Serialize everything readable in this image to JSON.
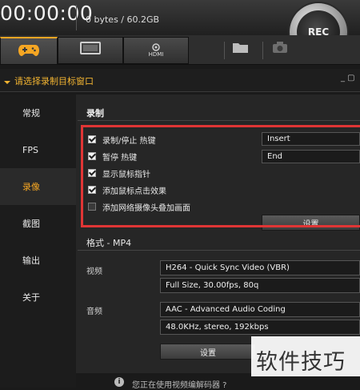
{
  "header": {
    "timer": "00:00:00",
    "storage": "0 bytes / 60.2GB",
    "rec_label": "REC"
  },
  "tabs": [
    {
      "name": "game",
      "icon": "gamepad-icon"
    },
    {
      "name": "screen",
      "icon": "monitor-icon"
    },
    {
      "name": "hdmi",
      "icon": "hdmi-icon",
      "label": "HDMI"
    }
  ],
  "toolbar": {
    "folder_icon": "folder-icon",
    "camera_icon": "camera-icon"
  },
  "window_row": {
    "label": "请选择录制目标窗口",
    "controls": "_ ▢"
  },
  "sidebar": {
    "items": [
      {
        "label": "常规"
      },
      {
        "label": "FPS"
      },
      {
        "label": "录像"
      },
      {
        "label": "截图"
      },
      {
        "label": "输出"
      },
      {
        "label": "关于"
      }
    ],
    "active_index": 2
  },
  "record": {
    "section_title": "录制",
    "options": [
      {
        "label": "录制/停止 热键",
        "checked": true,
        "hotkey": "Insert"
      },
      {
        "label": "暂停 热键",
        "checked": true,
        "hotkey": "End"
      },
      {
        "label": "显示鼠标指针",
        "checked": true
      },
      {
        "label": "添加鼠标点击效果",
        "checked": true
      },
      {
        "label": "添加网络摄像头叠加画面",
        "checked": false
      }
    ],
    "settings_button": "设置"
  },
  "format": {
    "title": "格式 - MP4",
    "video_label": "视频",
    "video_codec": "H264 - Quick Sync Video (VBR)",
    "video_info": "Full Size, 30.00fps, 80q",
    "audio_label": "音频",
    "audio_codec": "AAC - Advanced Audio Coding",
    "audio_info": "48.0KHz, stereo, 192kbps",
    "settings_button": "设置"
  },
  "bottom": {
    "info_glyph": "i",
    "text": "您正在使用视频编解码器 ?"
  },
  "watermark": "软件技巧",
  "colors": {
    "accent": "#f5a623",
    "highlight": "#e03535"
  }
}
